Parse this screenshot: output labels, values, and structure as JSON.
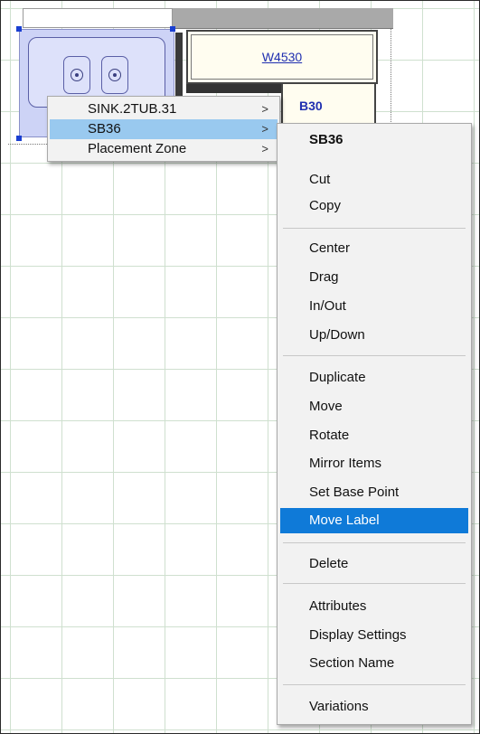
{
  "canvas": {
    "cabinets": [
      {
        "id": "w4530",
        "label": "W4530"
      },
      {
        "id": "b30",
        "label": "B30"
      }
    ]
  },
  "submenu_left": {
    "items": [
      {
        "label": "SINK.2TUB.31",
        "arrow": ">"
      },
      {
        "label": "SB36",
        "arrow": ">",
        "selected": true
      },
      {
        "label": "Placement Zone",
        "arrow": ">"
      }
    ]
  },
  "context_menu": {
    "title": "SB36",
    "groups": [
      [
        "Cut",
        "Copy"
      ],
      [
        "Center",
        "Drag",
        "In/Out",
        "Up/Down"
      ],
      [
        "Duplicate",
        "Move",
        "Rotate",
        "Mirror Items",
        "Set Base Point",
        "Move Label"
      ],
      [
        "Delete"
      ],
      [
        "Attributes",
        "Display Settings",
        "Section Name"
      ],
      [
        "Variations"
      ]
    ],
    "selected_item": "Move Label"
  },
  "colors": {
    "menu_highlight": "#0f7ad8",
    "submenu_highlight": "#99c9ef",
    "grid": "#cfe0cf",
    "label_blue": "#1f2fb0"
  }
}
